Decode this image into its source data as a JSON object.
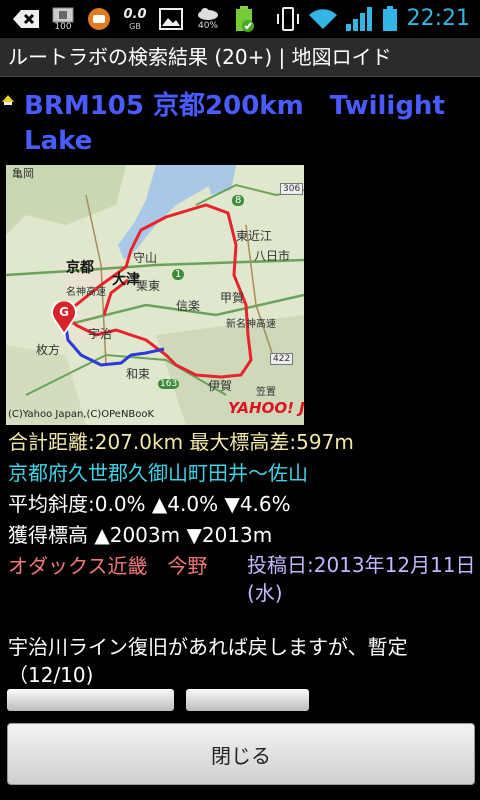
{
  "status_bar": {
    "time": "22:21",
    "battery_percent_label": "100",
    "data_rate": "0.0",
    "data_unit": "GB",
    "weather_percent": "40%"
  },
  "title_bar": {
    "title": "ルートラボの検索結果 (20+) | 地図ロイド"
  },
  "route": {
    "title_line1": "BRM105 京都200km　Twilight",
    "title_line2": "Lake",
    "distance": "合計距離:207.0km 最大標高差:597m",
    "location": "京都府久世郡久御山町田井～佐山",
    "slope": "平均斜度:0.0% ▲4.0% ▼4.6%",
    "elevation_gain": "獲得標高 ▲2003m ▼2013m",
    "author": "オダックス近畿　今野",
    "post_date": "投稿日:2013年12月11日(水)",
    "comment": "宇治川ライン復旧があれば戻しますが、暫定（12/10)"
  },
  "map": {
    "labels": {
      "kyoto": "京都",
      "otsu": "大津",
      "moriyama": "守山",
      "higashiomi": "東近江",
      "yokaichi": "八日市",
      "ritto": "栗東",
      "shigaraki": "信楽",
      "koka": "甲賀",
      "uji": "宇治",
      "wazuka": "和束",
      "iga": "伊賀",
      "kameoka": "亀岡",
      "hirakata": "枚方",
      "kasagi": "笠置",
      "shinmeishin": "新名神高速",
      "meishin": "名神高速",
      "route1": "1",
      "route163": "163",
      "route306": "306",
      "route422": "422",
      "route8": "8",
      "marker": "G"
    },
    "copyright": "(C)Yahoo Japan,(C)OPeNBooK",
    "logo": "YAHOO! JAPAN",
    "route_color": "#e8232b",
    "alt_route_color": "#2b3ad8"
  },
  "buttons": {
    "close": "閉じる"
  }
}
